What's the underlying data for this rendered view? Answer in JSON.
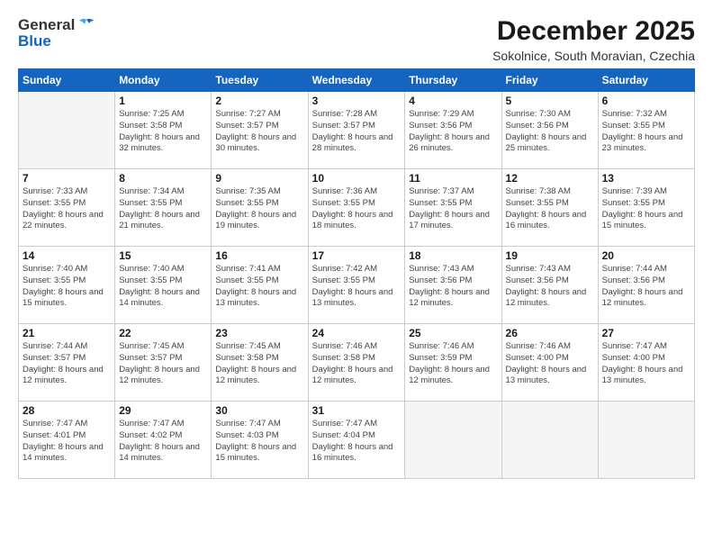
{
  "logo": {
    "general": "General",
    "blue": "Blue"
  },
  "title": "December 2025",
  "location": "Sokolnice, South Moravian, Czechia",
  "days_header": [
    "Sunday",
    "Monday",
    "Tuesday",
    "Wednesday",
    "Thursday",
    "Friday",
    "Saturday"
  ],
  "weeks": [
    [
      {
        "num": "",
        "empty": true
      },
      {
        "num": "1",
        "sunrise": "Sunrise: 7:25 AM",
        "sunset": "Sunset: 3:58 PM",
        "daylight": "Daylight: 8 hours and 32 minutes."
      },
      {
        "num": "2",
        "sunrise": "Sunrise: 7:27 AM",
        "sunset": "Sunset: 3:57 PM",
        "daylight": "Daylight: 8 hours and 30 minutes."
      },
      {
        "num": "3",
        "sunrise": "Sunrise: 7:28 AM",
        "sunset": "Sunset: 3:57 PM",
        "daylight": "Daylight: 8 hours and 28 minutes."
      },
      {
        "num": "4",
        "sunrise": "Sunrise: 7:29 AM",
        "sunset": "Sunset: 3:56 PM",
        "daylight": "Daylight: 8 hours and 26 minutes."
      },
      {
        "num": "5",
        "sunrise": "Sunrise: 7:30 AM",
        "sunset": "Sunset: 3:56 PM",
        "daylight": "Daylight: 8 hours and 25 minutes."
      },
      {
        "num": "6",
        "sunrise": "Sunrise: 7:32 AM",
        "sunset": "Sunset: 3:55 PM",
        "daylight": "Daylight: 8 hours and 23 minutes."
      }
    ],
    [
      {
        "num": "7",
        "sunrise": "Sunrise: 7:33 AM",
        "sunset": "Sunset: 3:55 PM",
        "daylight": "Daylight: 8 hours and 22 minutes."
      },
      {
        "num": "8",
        "sunrise": "Sunrise: 7:34 AM",
        "sunset": "Sunset: 3:55 PM",
        "daylight": "Daylight: 8 hours and 21 minutes."
      },
      {
        "num": "9",
        "sunrise": "Sunrise: 7:35 AM",
        "sunset": "Sunset: 3:55 PM",
        "daylight": "Daylight: 8 hours and 19 minutes."
      },
      {
        "num": "10",
        "sunrise": "Sunrise: 7:36 AM",
        "sunset": "Sunset: 3:55 PM",
        "daylight": "Daylight: 8 hours and 18 minutes."
      },
      {
        "num": "11",
        "sunrise": "Sunrise: 7:37 AM",
        "sunset": "Sunset: 3:55 PM",
        "daylight": "Daylight: 8 hours and 17 minutes."
      },
      {
        "num": "12",
        "sunrise": "Sunrise: 7:38 AM",
        "sunset": "Sunset: 3:55 PM",
        "daylight": "Daylight: 8 hours and 16 minutes."
      },
      {
        "num": "13",
        "sunrise": "Sunrise: 7:39 AM",
        "sunset": "Sunset: 3:55 PM",
        "daylight": "Daylight: 8 hours and 15 minutes."
      }
    ],
    [
      {
        "num": "14",
        "sunrise": "Sunrise: 7:40 AM",
        "sunset": "Sunset: 3:55 PM",
        "daylight": "Daylight: 8 hours and 15 minutes."
      },
      {
        "num": "15",
        "sunrise": "Sunrise: 7:40 AM",
        "sunset": "Sunset: 3:55 PM",
        "daylight": "Daylight: 8 hours and 14 minutes."
      },
      {
        "num": "16",
        "sunrise": "Sunrise: 7:41 AM",
        "sunset": "Sunset: 3:55 PM",
        "daylight": "Daylight: 8 hours and 13 minutes."
      },
      {
        "num": "17",
        "sunrise": "Sunrise: 7:42 AM",
        "sunset": "Sunset: 3:55 PM",
        "daylight": "Daylight: 8 hours and 13 minutes."
      },
      {
        "num": "18",
        "sunrise": "Sunrise: 7:43 AM",
        "sunset": "Sunset: 3:56 PM",
        "daylight": "Daylight: 8 hours and 12 minutes."
      },
      {
        "num": "19",
        "sunrise": "Sunrise: 7:43 AM",
        "sunset": "Sunset: 3:56 PM",
        "daylight": "Daylight: 8 hours and 12 minutes."
      },
      {
        "num": "20",
        "sunrise": "Sunrise: 7:44 AM",
        "sunset": "Sunset: 3:56 PM",
        "daylight": "Daylight: 8 hours and 12 minutes."
      }
    ],
    [
      {
        "num": "21",
        "sunrise": "Sunrise: 7:44 AM",
        "sunset": "Sunset: 3:57 PM",
        "daylight": "Daylight: 8 hours and 12 minutes."
      },
      {
        "num": "22",
        "sunrise": "Sunrise: 7:45 AM",
        "sunset": "Sunset: 3:57 PM",
        "daylight": "Daylight: 8 hours and 12 minutes."
      },
      {
        "num": "23",
        "sunrise": "Sunrise: 7:45 AM",
        "sunset": "Sunset: 3:58 PM",
        "daylight": "Daylight: 8 hours and 12 minutes."
      },
      {
        "num": "24",
        "sunrise": "Sunrise: 7:46 AM",
        "sunset": "Sunset: 3:58 PM",
        "daylight": "Daylight: 8 hours and 12 minutes."
      },
      {
        "num": "25",
        "sunrise": "Sunrise: 7:46 AM",
        "sunset": "Sunset: 3:59 PM",
        "daylight": "Daylight: 8 hours and 12 minutes."
      },
      {
        "num": "26",
        "sunrise": "Sunrise: 7:46 AM",
        "sunset": "Sunset: 4:00 PM",
        "daylight": "Daylight: 8 hours and 13 minutes."
      },
      {
        "num": "27",
        "sunrise": "Sunrise: 7:47 AM",
        "sunset": "Sunset: 4:00 PM",
        "daylight": "Daylight: 8 hours and 13 minutes."
      }
    ],
    [
      {
        "num": "28",
        "sunrise": "Sunrise: 7:47 AM",
        "sunset": "Sunset: 4:01 PM",
        "daylight": "Daylight: 8 hours and 14 minutes."
      },
      {
        "num": "29",
        "sunrise": "Sunrise: 7:47 AM",
        "sunset": "Sunset: 4:02 PM",
        "daylight": "Daylight: 8 hours and 14 minutes."
      },
      {
        "num": "30",
        "sunrise": "Sunrise: 7:47 AM",
        "sunset": "Sunset: 4:03 PM",
        "daylight": "Daylight: 8 hours and 15 minutes."
      },
      {
        "num": "31",
        "sunrise": "Sunrise: 7:47 AM",
        "sunset": "Sunset: 4:04 PM",
        "daylight": "Daylight: 8 hours and 16 minutes."
      },
      {
        "num": "",
        "empty": true
      },
      {
        "num": "",
        "empty": true
      },
      {
        "num": "",
        "empty": true
      }
    ]
  ]
}
